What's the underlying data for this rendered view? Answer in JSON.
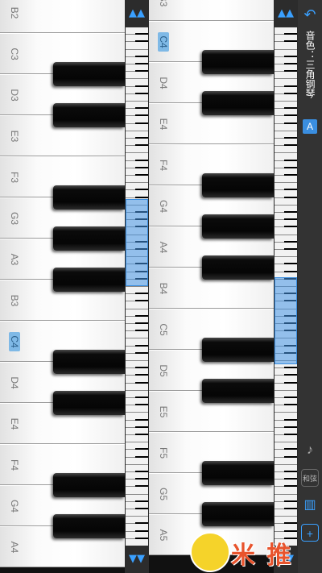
{
  "left_panel": {
    "labels": [
      "B2",
      "C3",
      "D3",
      "E3",
      "F3",
      "G3",
      "A3",
      "B3",
      "C4",
      "D4",
      "E4",
      "F4",
      "G4",
      "A4"
    ],
    "highlight": "C4"
  },
  "right_panel": {
    "labels": [
      "B3",
      "C4",
      "D4",
      "E4",
      "F4",
      "G4",
      "A4",
      "B4",
      "C5",
      "D5",
      "E5",
      "F5",
      "G5",
      "A5"
    ],
    "highlight": "C4"
  },
  "strip_left": {
    "up_icon": "▲▲",
    "down_icon": "▼▼"
  },
  "strip_right": {
    "up_icon": "▲▲",
    "down_icon": "▼▼"
  },
  "sidebar": {
    "back_icon": "↶",
    "timbre_label": "音色：三角钢琴",
    "notation_badge": "A",
    "tools": [
      "notes-tool-icon",
      "和弦",
      "piano-keys-icon",
      "add-keyboard-icon"
    ],
    "chord_label": "和弦"
  },
  "watermark": {
    "text": "米 推"
  }
}
